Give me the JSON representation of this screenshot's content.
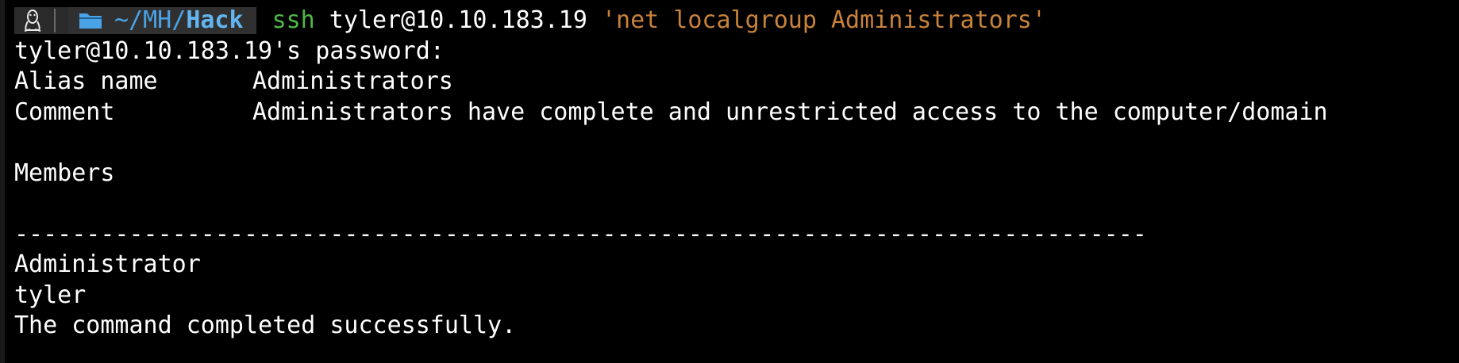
{
  "prompt": {
    "os_icon": "linux-tux-icon",
    "folder_icon": "folder-icon",
    "dir_prefix": "~/MH/",
    "dir_current": "Hack",
    "command": "ssh",
    "args": " tyler@10.10.183.19 ",
    "quoted": "'net localgroup Administrators'"
  },
  "output": {
    "password_prompt": "tyler@10.10.183.19's password:",
    "alias_label": "Alias name",
    "alias_value": "Administrators",
    "comment_label": "Comment",
    "comment_value": "Administrators have complete and unrestricted access to the computer/domain",
    "members_heading": "Members",
    "divider": "-------------------------------------------------------------------------------",
    "members": [
      "Administrator",
      "tyler"
    ],
    "status": "The command completed successfully."
  },
  "colors": {
    "background": "#000000",
    "text": "#ffffff",
    "command": "#4fb848",
    "string": "#c8823a",
    "directory": "#4aa3e6"
  }
}
